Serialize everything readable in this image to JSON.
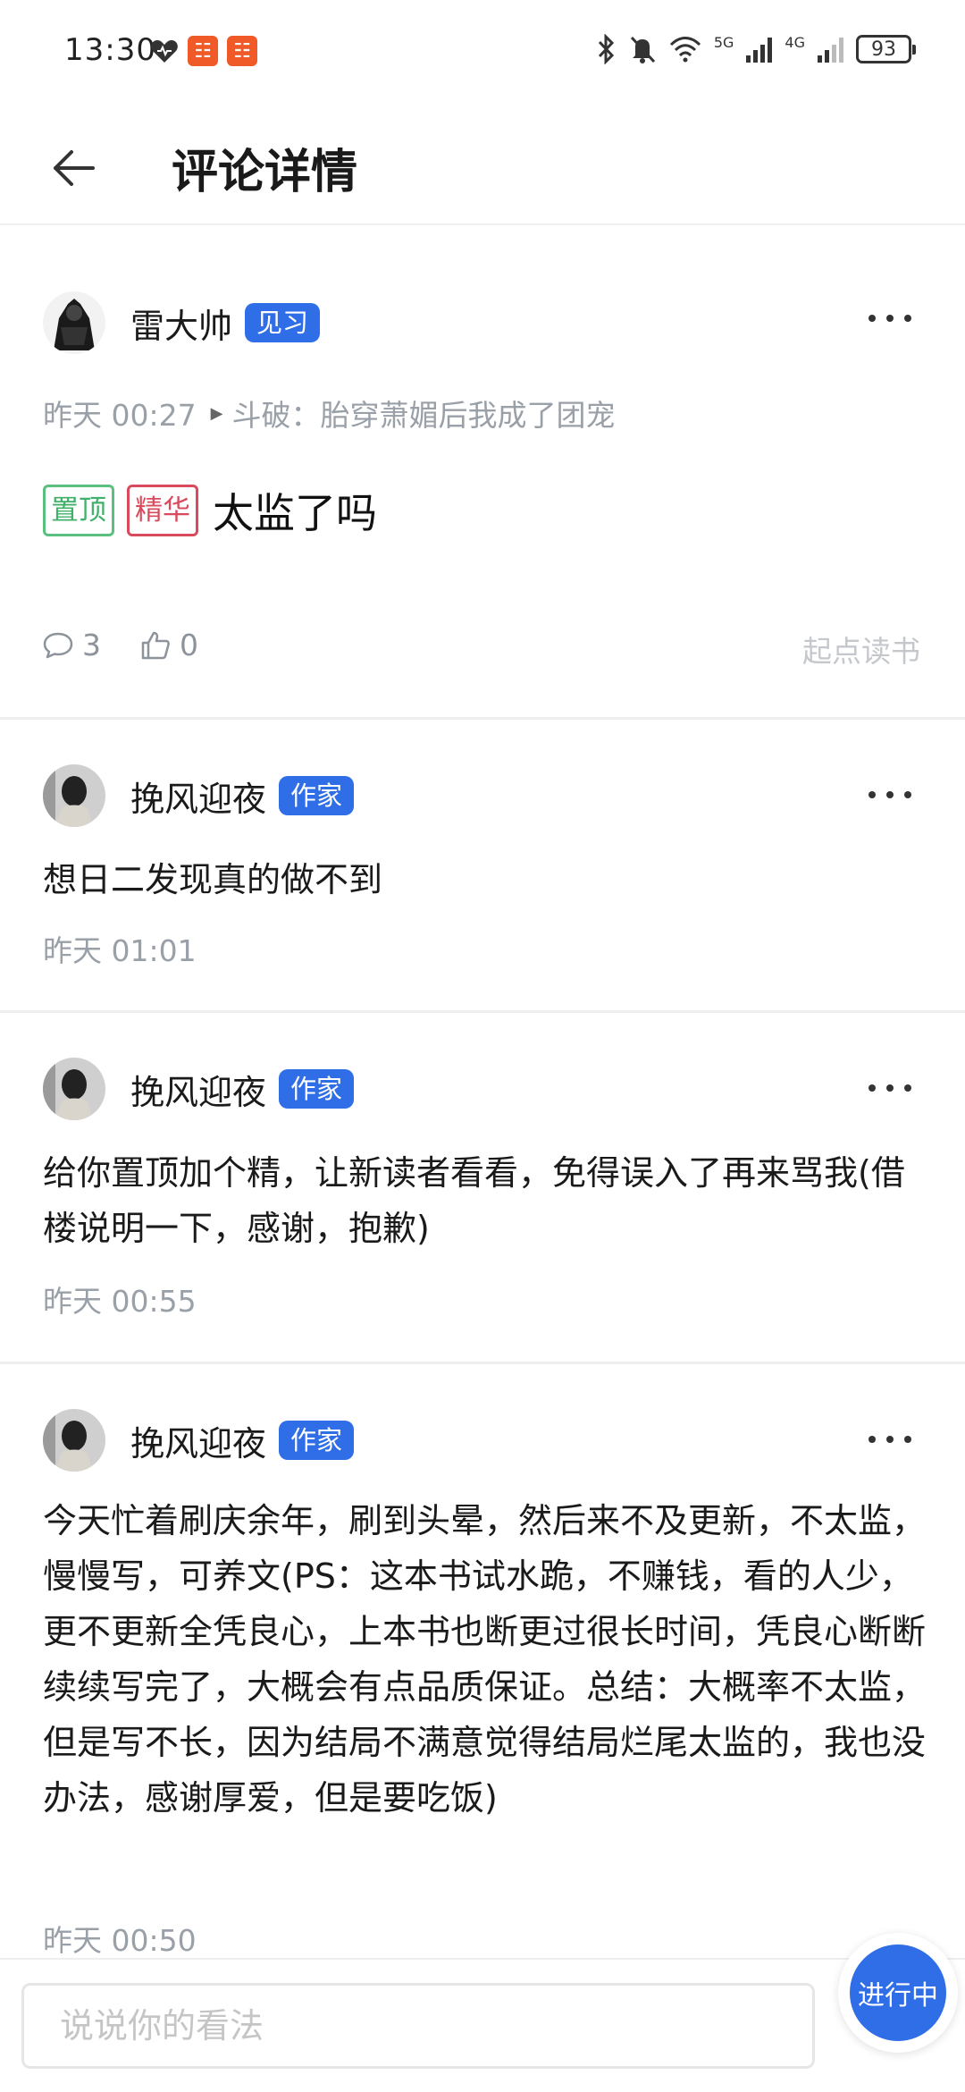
{
  "status_bar": {
    "time": "13:30",
    "network_5g": "5G",
    "network_4g": "4G",
    "battery": "93"
  },
  "header": {
    "title": "评论详情"
  },
  "main_post": {
    "user_name": "雷大帅",
    "user_badge": "见习",
    "time": "昨天 00:27",
    "book": "斗破：胎穿萧媚后我成了团宠",
    "tags": [
      "置顶",
      "精华"
    ],
    "text": "太监了吗",
    "comment_count": "3",
    "like_count": "0",
    "source": "起点读书"
  },
  "replies": [
    {
      "user_name": "挽风迎夜",
      "badge": "作家",
      "text": "想日二发现真的做不到",
      "time": "昨天 01:01"
    },
    {
      "user_name": "挽风迎夜",
      "badge": "作家",
      "text": "给你置顶加个精，让新读者看看，免得误入了再来骂我(借楼说明一下，感谢，抱歉)",
      "time": "昨天 00:55"
    },
    {
      "user_name": "挽风迎夜",
      "badge": "作家",
      "text": "今天忙着刷庆余年，刷到头晕，然后来不及更新，不太监，慢慢写，可养文(PS：这本书试水跪，不赚钱，看的人少，更不更新全凭良心，上本书也断更过很长时间，凭良心断断续续写完了，大概会有点品质保证。总结：大概率不太监，但是写不长，因为结局不满意觉得结局烂尾太监的，我也没办法，感谢厚爱，但是要吃饭)",
      "time": "昨天 00:50"
    }
  ],
  "bottom_bar": {
    "input_placeholder": "说说你的看法",
    "progress_label": "进行中"
  },
  "colors": {
    "accent": "#2f6ee6",
    "tag_top": "#40b06a",
    "tag_essence": "#d84a5c",
    "meta_text": "#9aa0a8"
  }
}
